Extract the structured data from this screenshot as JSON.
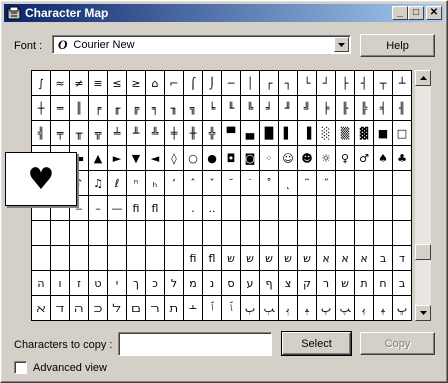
{
  "window": {
    "title": "Character Map"
  },
  "controls": {
    "minimize_glyph": "_",
    "maximize_glyph": "□",
    "close_glyph": "✕"
  },
  "font": {
    "label": "Font :",
    "value": "Courier New",
    "icon_glyph": "O"
  },
  "buttons": {
    "help": "Help",
    "select": "Select",
    "copy": "Copy"
  },
  "copy_area": {
    "label": "Characters to copy :",
    "value": ""
  },
  "advanced_view": {
    "label": "Advanced view",
    "checked": false
  },
  "magnified_char": "♥",
  "grid": {
    "rows": [
      [
        "∫",
        "≈",
        "≠",
        "≡",
        "≤",
        "≥",
        "⌂",
        "⌐",
        "⌠",
        "⌡",
        "─",
        "│",
        "┌",
        "┐",
        "└",
        "┘",
        "├",
        "┤",
        "┬",
        "┴"
      ],
      [
        "┼",
        "═",
        "║",
        "╒",
        "╓",
        "╔",
        "╕",
        "╖",
        "╗",
        "╘",
        "╙",
        "╚",
        "╛",
        "╜",
        "╝",
        "╞",
        "╟",
        "╠",
        "╡",
        "╢"
      ],
      [
        "╣",
        "╤",
        "╥",
        "╦",
        "╧",
        "╨",
        "╩",
        "╪",
        "╫",
        "╬",
        "▀",
        "▄",
        "█",
        "▌",
        "▐",
        "░",
        "▒",
        "▓",
        "■",
        "□"
      ],
      [
        "▪",
        "▫",
        "▬",
        "▲",
        "►",
        "▼",
        "◄",
        "◊",
        "○",
        "●",
        "◘",
        "◙",
        "◦",
        "☺",
        "☻",
        "☼",
        "♀",
        "♂",
        "♠",
        "♣"
      ],
      [
        "♥",
        "♦",
        "♪",
        "♫",
        "ℓ",
        "ⁿ",
        "ₕ",
        "ʼ",
        "ˆ",
        "ˇ",
        "˘",
        "˙",
        "˚",
        "˛",
        "˜",
        "˝",
        "",
        "",
        "",
        ""
      ],
      [
        "",
        "",
        "‒",
        "–",
        "—",
        "fi",
        "fl",
        "",
        ".",
        "..",
        "",
        "",
        "",
        "",
        "",
        "",
        "",
        "",
        "",
        ""
      ],
      [
        "",
        "",
        "",
        "",
        "",
        "",
        "",
        "",
        "",
        "",
        "",
        "",
        "",
        "",
        "",
        "",
        "",
        "",
        "",
        ""
      ],
      [
        "",
        "",
        "",
        "",
        "",
        "",
        "",
        "",
        "fi",
        "fl",
        "ש",
        "ש",
        "ש",
        "ש",
        "ש",
        "א",
        "א",
        "א",
        "ב",
        "ד"
      ],
      [
        "ה",
        "ו",
        "ז",
        "ט",
        "י",
        "ך",
        "כ",
        "ל",
        "מ",
        "נ",
        "ס",
        "ע",
        "ף",
        "צ",
        "ק",
        "ר",
        "ש",
        "ת",
        "ח",
        "ב"
      ],
      [
        "ﬡ",
        "ﬢ",
        "ﬣ",
        "ﬤ",
        "ﬥ",
        "ﬦ",
        "ﬧ",
        "ﬨ",
        "﬩",
        "ﭐ",
        "ﭑ",
        "ﭒ",
        "ﭓ",
        "ﭔ",
        "ﭕ",
        "ﭖ",
        "ﭗ",
        "ﭘ",
        "ﭙ",
        "ﭚ"
      ]
    ]
  }
}
